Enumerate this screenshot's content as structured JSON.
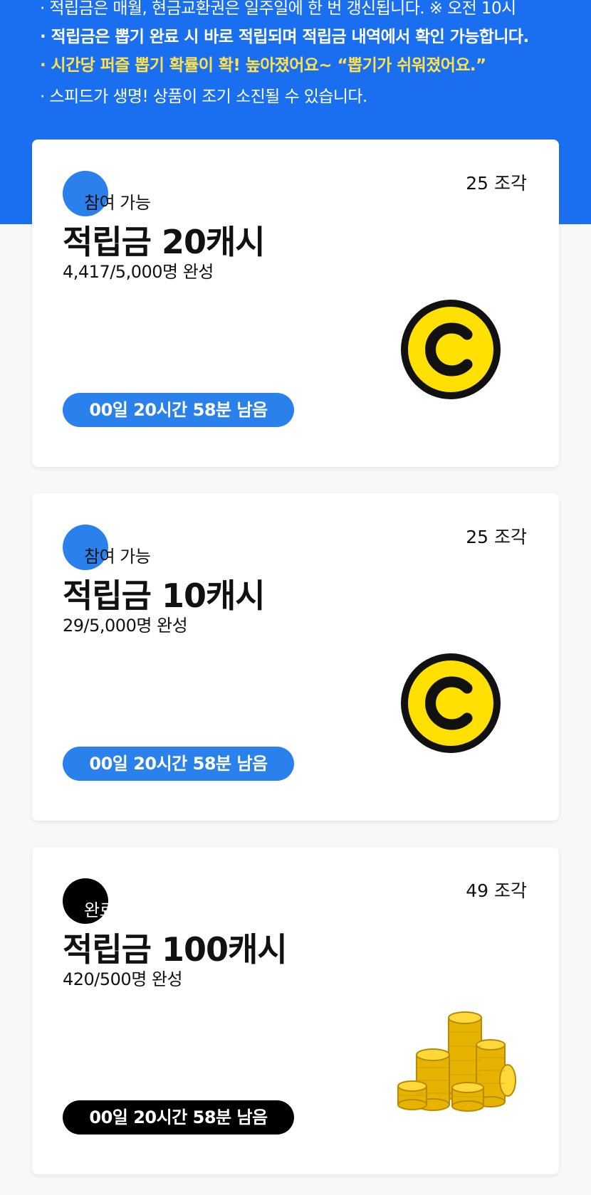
{
  "notices": [
    "· 적립금은 매월, 현금교환권은 일주일에 한 번 갱신됩니다. ※ 오전 10시",
    "· 적립금은 뽑기 완료 시 바로 적립되며 적립금 내역에서 확인 가능합니다.",
    "· 시간당 퍼즐 뽑기 확률이 확! 높아졌어요~ “뽑기가 쉬워졌어요.”",
    "· 스피드가 생명! 상품이 조기 소진될 수 있습니다."
  ],
  "colors": {
    "banner": "#1a6ff0",
    "highlight": "#ffe24a",
    "accent": "#2a81ec",
    "done": "#000000",
    "coin_yellow": "#ffe000"
  },
  "cards": [
    {
      "status": "참여 가능",
      "pieces": "25 조각",
      "title": "적립금 20캐시",
      "progress": "4,417/5,000명 완성",
      "timer": "00일 20시간 58분 남음",
      "icon": "cash-coin-icon"
    },
    {
      "status": "참여 가능",
      "pieces": "25 조각",
      "title": "적립금 10캐시",
      "progress": "29/5,000명 완성",
      "timer": "00일 20시간 58분 남음",
      "icon": "cash-coin-icon"
    },
    {
      "status": "완료",
      "pieces": "49 조각",
      "title": "적립금 100캐시",
      "progress": "420/500명 완성",
      "timer": "00일 20시간 58분 남음",
      "icon": "gold-coins-icon"
    }
  ]
}
